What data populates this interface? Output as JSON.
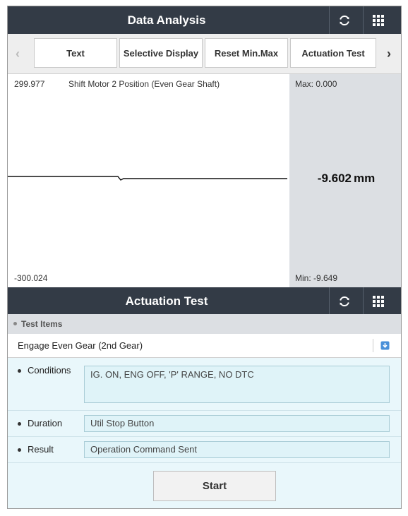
{
  "data_analysis": {
    "title": "Data Analysis",
    "toolbar": {
      "prev_icon": "chevron-left-icon",
      "next_icon": "chevron-right-icon",
      "buttons": [
        "Text",
        "Selective Display",
        "Reset Min.Max",
        "Actuation Test"
      ]
    },
    "graph": {
      "upper_value": "299.977",
      "lower_value": "-300.024",
      "signal_name": "Shift Motor 2 Position (Even Gear Shaft)",
      "max_label": "Max: 0.000",
      "min_label": "Min: -9.649",
      "current_value": "-9.602",
      "unit": "mm"
    }
  },
  "actuation_test": {
    "title": "Actuation Test",
    "test_items_label": "Test Items",
    "selected_item": "Engage Even Gear (2nd Gear)",
    "conditions_label": "Conditions",
    "conditions_value": "IG. ON, ENG OFF, 'P' RANGE, NO DTC",
    "duration_label": "Duration",
    "duration_value": "Util Stop Button",
    "result_label": "Result",
    "result_value": "Operation Command Sent",
    "start_label": "Start"
  },
  "colors": {
    "header_bg": "#333b46",
    "panel_bg": "#dcdfe3",
    "actuation_bg": "#e9f7fb",
    "field_border": "#a9ccd6",
    "download_icon": "#4a90d9"
  }
}
